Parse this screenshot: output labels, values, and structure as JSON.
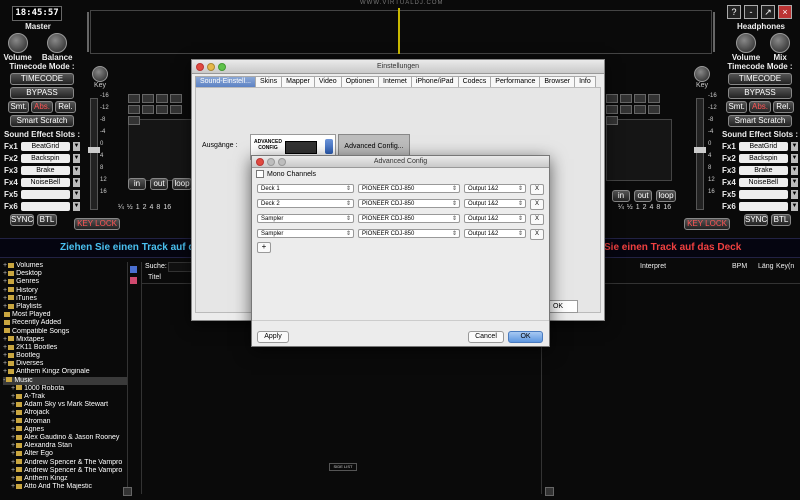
{
  "clock": "18:45:57",
  "brand": "WWW.VIRTUALDJ.COM",
  "window_buttons": [
    "?",
    "-",
    "↗",
    "×"
  ],
  "left_knobs": {
    "title": "Master",
    "labels": [
      "Volume",
      "Balance"
    ]
  },
  "right_knobs": {
    "title": "Headphones",
    "labels": [
      "Volume",
      "Mix"
    ]
  },
  "key_label": "Key",
  "timecode": {
    "title": "Timecode Mode :",
    "timecode_btn": "TIMECODE",
    "bypass_btn": "BYPASS",
    "modes": [
      "Smt.",
      "Abs.",
      "Rel."
    ],
    "smart_scratch": "Smart Scratch"
  },
  "fx": {
    "title": "Sound Effect Slots :",
    "slots": [
      {
        "label": "Fx1",
        "value": "BeatGrid"
      },
      {
        "label": "Fx2",
        "value": "Backspin"
      },
      {
        "label": "Fx3",
        "value": "Brake"
      },
      {
        "label": "Fx4",
        "value": "NoiseBell"
      },
      {
        "label": "Fx5",
        "value": ""
      },
      {
        "label": "Fx6",
        "value": ""
      }
    ]
  },
  "sync": "SYNC",
  "btl": "BTL",
  "key_lock": "KEY LOCK",
  "loop_labels": [
    "in",
    "out",
    "loop"
  ],
  "loop_sizes": [
    "¼",
    "½",
    "1",
    "2",
    "4",
    "8",
    "16"
  ],
  "pitch_scale": [
    "-16",
    "-12",
    "-8",
    "-4",
    "0",
    "4",
    "8",
    "12",
    "16"
  ],
  "banner": {
    "left": "Ziehen Sie einen Track auf d",
    "right": "Sie einen Track auf das Deck"
  },
  "search_label": "Suche:",
  "columns": {
    "title": "Titel",
    "artist": "Interpret",
    "bpm": "BPM",
    "length": "Läng",
    "key": "Key(n"
  },
  "side_list": "SIDE LIST",
  "tree": [
    {
      "name": "Volumes",
      "exp": "+",
      "indent": 0
    },
    {
      "name": "Desktop",
      "exp": "+",
      "indent": 0
    },
    {
      "name": "Genres",
      "exp": "+",
      "indent": 0
    },
    {
      "name": "History",
      "exp": "+",
      "indent": 0
    },
    {
      "name": "iTunes",
      "exp": "+",
      "indent": 0
    },
    {
      "name": "Playlists",
      "exp": "+",
      "indent": 0
    },
    {
      "name": "Most Played",
      "exp": "",
      "indent": 0
    },
    {
      "name": "Recently Added",
      "exp": "",
      "indent": 0
    },
    {
      "name": "Compatible Songs",
      "exp": "",
      "indent": 0
    },
    {
      "name": "Mixtapes",
      "exp": "+",
      "indent": 0
    },
    {
      "name": "2K11 Bootles",
      "exp": "+",
      "indent": 0
    },
    {
      "name": "Bootleg",
      "exp": "+",
      "indent": 0
    },
    {
      "name": "Diverses",
      "exp": "+",
      "indent": 0
    },
    {
      "name": "Anthem Kingz Originale",
      "exp": "+",
      "indent": 0
    },
    {
      "name": "Music",
      "exp": "-",
      "indent": 0
    },
    {
      "name": "1000 Robota",
      "exp": "+",
      "indent": 1
    },
    {
      "name": "A-Trak",
      "exp": "+",
      "indent": 1
    },
    {
      "name": "Adam Sky vs Mark Stewart",
      "exp": "+",
      "indent": 1
    },
    {
      "name": "Afrojack",
      "exp": "+",
      "indent": 1
    },
    {
      "name": "Afroman",
      "exp": "+",
      "indent": 1
    },
    {
      "name": "Agnes",
      "exp": "+",
      "indent": 1
    },
    {
      "name": "Alex Gaudino & Jason Rooney",
      "exp": "+",
      "indent": 1
    },
    {
      "name": "Alexandra Stan",
      "exp": "+",
      "indent": 1
    },
    {
      "name": "Alter Ego",
      "exp": "+",
      "indent": 1
    },
    {
      "name": "Andrew Spencer & The Vampro",
      "exp": "+",
      "indent": 1
    },
    {
      "name": "Andrew Spencer & The Vampro",
      "exp": "+",
      "indent": 1
    },
    {
      "name": "Anthem Kingz",
      "exp": "+",
      "indent": 1
    },
    {
      "name": "Atto And The Majestic",
      "exp": "+",
      "indent": 1
    }
  ],
  "settings": {
    "title": "Einstellungen",
    "tabs": [
      "Sound-Einstell...",
      "Skins",
      "Mapper",
      "Video",
      "Optionen",
      "Internet",
      "iPhone/iPad",
      "Codecs",
      "Performance",
      "Browser",
      "Info"
    ],
    "outputs_label": "Ausgänge :",
    "adv_box_text": "ADVANCED CONFIG",
    "adv_button": "Advanced Config...",
    "ok": "OK"
  },
  "advanced": {
    "title": "Advanced Config",
    "mono": "Mono Channels",
    "rows": [
      {
        "channel": "Deck 1",
        "device": "PIONEER CDJ-850",
        "output": "Output 1&2",
        "remove": "X"
      },
      {
        "channel": "Deck 2",
        "device": "PIONEER CDJ-850",
        "output": "Output 1&2",
        "remove": "X"
      },
      {
        "channel": "Sampler",
        "device": "PIONEER CDJ-850",
        "output": "Output 1&2",
        "remove": "X"
      },
      {
        "channel": "Sampler",
        "device": "PIONEER CDJ-850",
        "output": "Output 1&2",
        "remove": "X"
      }
    ],
    "add": "+",
    "apply": "Apply",
    "cancel": "Cancel",
    "ok": "OK"
  }
}
